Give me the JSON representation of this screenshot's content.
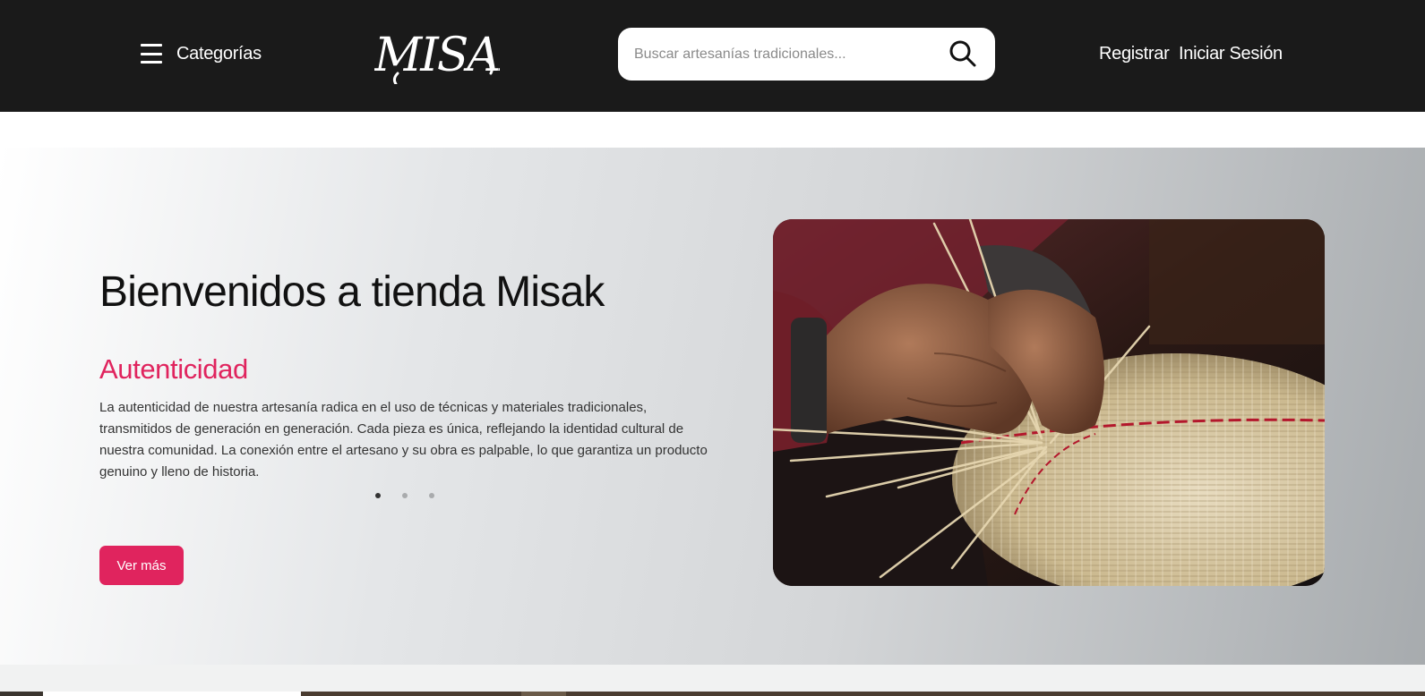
{
  "header": {
    "categories_label": "Categorías",
    "logo_text": "MISAK",
    "search": {
      "placeholder": "Buscar artesanías tradicionales...",
      "value": ""
    },
    "register_label": "Registrar",
    "login_label": "Iniciar Sesión"
  },
  "hero": {
    "title": "Bienvenidos a tienda Misak",
    "slide": {
      "heading": "Autenticidad",
      "text": "La autenticidad de nuestra artesanía radica en el uso de técnicas y materiales tradicionales, transmitidos de generación en generación. Cada pieza es única, reflejando la identidad cultural de nuestra comunidad. La conexión entre el artesano y su obra es palpable, lo que garantiza un producto genuino y lleno de historia."
    },
    "carousel": {
      "slide_count": 3,
      "active_index": 0
    },
    "cta_label": "Ver más",
    "image": {
      "subject": "artisan hands weaving a straw basket"
    }
  },
  "colors": {
    "header_bg": "#1a1a1a",
    "accent": "#e0245e",
    "text_dark": "#111111",
    "icon_search": "search-icon",
    "icon_menu": "hamburger-menu-icon"
  }
}
